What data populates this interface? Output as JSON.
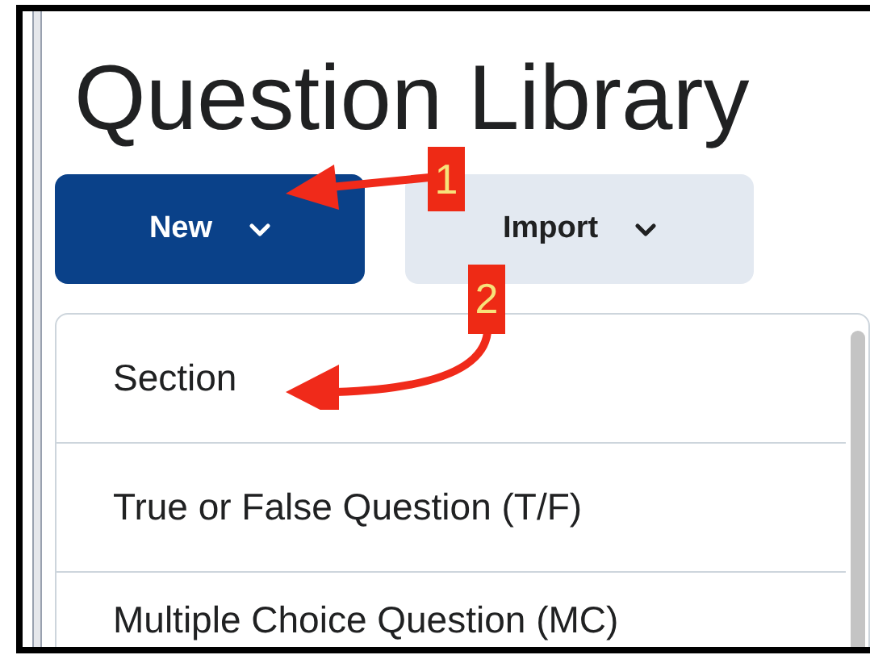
{
  "page": {
    "title": "Question Library"
  },
  "buttons": [
    {
      "label": "New",
      "kind": "primary"
    },
    {
      "label": "Import",
      "kind": "secondary"
    }
  ],
  "menu": {
    "items": [
      {
        "label": "Section"
      },
      {
        "label": "True or False Question (T/F)"
      },
      {
        "label": "Multiple Choice Question (MC)"
      }
    ]
  },
  "annotations": [
    {
      "label": "1"
    },
    {
      "label": "2"
    }
  ]
}
